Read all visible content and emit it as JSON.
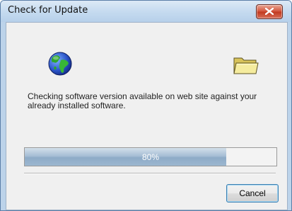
{
  "window": {
    "title": "Check for Update",
    "close_icon": "close-icon"
  },
  "content": {
    "globe_icon": "globe-icon",
    "folder_icon": "folder-icon",
    "message": "Checking  software version available on web site against your already installed software."
  },
  "progress": {
    "value": 0.8,
    "label": "80%"
  },
  "buttons": {
    "cancel_label": "Cancel"
  },
  "colors": {
    "title_bar": "#c6dbf0",
    "progress_fill": "#9cb7d0",
    "close_button": "#c1391f"
  }
}
